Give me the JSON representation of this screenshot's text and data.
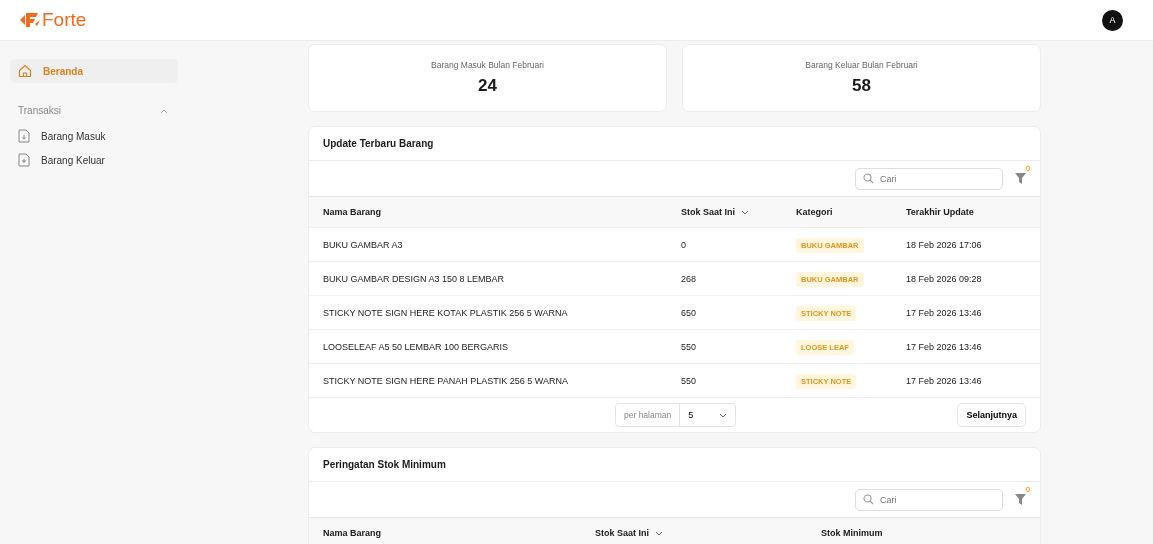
{
  "header": {
    "logo": "Forte",
    "avatar": "A"
  },
  "sidebar": {
    "items": [
      {
        "label": "Beranda",
        "selected": true,
        "kind": "home"
      }
    ],
    "sections": [
      {
        "title": "Transaksi",
        "expanded": true,
        "items": [
          {
            "label": "Barang Masuk",
            "selected": false,
            "kind": "in"
          },
          {
            "label": "Barang Keluar",
            "selected": false,
            "kind": "out"
          }
        ]
      }
    ]
  },
  "stats": [
    {
      "label": "Barang Masuk Bulan Februari",
      "value": "24"
    },
    {
      "label": "Barang Keluar Bulan Februari",
      "value": "58"
    }
  ],
  "tables": [
    {
      "title": "Update Terbaru Barang",
      "search": {
        "placeholder": "Cari"
      },
      "filter_count": "0",
      "columns": [
        {
          "label": "Nama Barang",
          "sortable": false
        },
        {
          "label": "Stok Saat Ini",
          "sortable": true
        },
        {
          "label": "Kategori",
          "sortable": false
        },
        {
          "label": "Terakhir Update",
          "sortable": false
        }
      ],
      "rows": [
        {
          "name": "BUKU GAMBAR A3",
          "stock": "0",
          "category": "BUKU GAMBAR",
          "updated": "18 Feb 2026 17:06"
        },
        {
          "name": "BUKU GAMBAR DESIGN A3 150 8 LEMBAR",
          "stock": "268",
          "category": "BUKU GAMBAR",
          "updated": "18 Feb 2026 09:28"
        },
        {
          "name": "STICKY NOTE SIGN HERE KOTAK PLASTIK 256 5 WARNA",
          "stock": "650",
          "category": "STICKY NOTE",
          "updated": "17 Feb 2026 13:46"
        },
        {
          "name": "LOOSELEAF A5 50 LEMBAR 100 BERGARIS",
          "stock": "550",
          "category": "LOOSE LEAF",
          "updated": "17 Feb 2026 13:46"
        },
        {
          "name": "STICKY NOTE SIGN HERE PANAH PLASTIK 256 5 WARNA",
          "stock": "550",
          "category": "STICKY NOTE",
          "updated": "17 Feb 2026 13:46"
        }
      ],
      "pagination": {
        "label": "per halaman",
        "value": "5",
        "next": "Selanjutnya"
      }
    },
    {
      "title": "Peringatan Stok Minimum",
      "search": {
        "placeholder": "Cari"
      },
      "filter_count": "0",
      "columns": [
        {
          "label": "Nama Barang",
          "sortable": false
        },
        {
          "label": "Stok Saat Ini",
          "sortable": true
        },
        {
          "label": "Stok Minimum",
          "sortable": false
        }
      ]
    }
  ]
}
